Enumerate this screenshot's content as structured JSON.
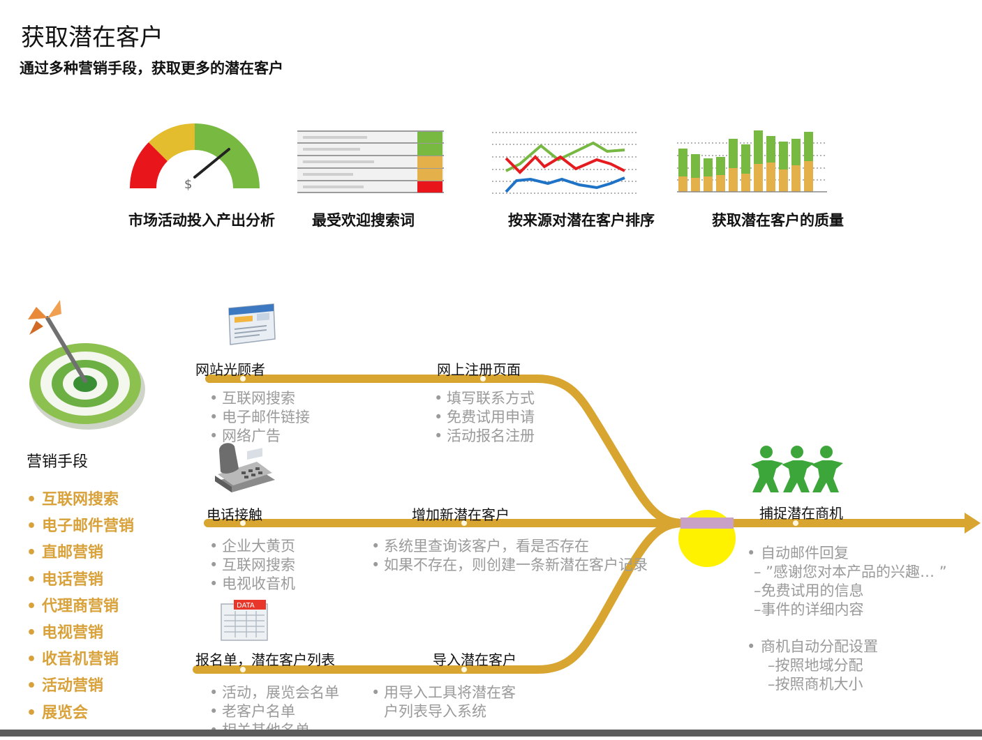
{
  "page": {
    "title": "获取潜在客户",
    "subtitle": "通过多种营销手段，获取更多的潜在客户"
  },
  "kpis": [
    {
      "label": "市场活动投入产出分析",
      "icon": "gauge-icon"
    },
    {
      "label": "最受欢迎搜索词",
      "icon": "table-bars-icon"
    },
    {
      "label": "按来源对潜在客户排序",
      "icon": "line-chart-icon"
    },
    {
      "label": "获取潜在客户的质量",
      "icon": "stacked-bar-icon"
    }
  ],
  "gauge": {
    "symbol": "$"
  },
  "marketing": {
    "heading": "营销手段",
    "items": [
      "互联网搜索",
      "电子邮件营销",
      "直邮营销",
      "电话营销",
      "代理商营销",
      "电视营销",
      "收音机营销",
      "活动营销",
      "展览会"
    ]
  },
  "stages": {
    "web_visitor": {
      "label": "网站光顾者",
      "bullets": [
        "互联网搜索",
        "电子邮件链接",
        "网络广告"
      ]
    },
    "web_register": {
      "label": "网上注册页面",
      "bullets": [
        "填写联系方式",
        "免费试用申请",
        "活动报名注册"
      ]
    },
    "phone": {
      "label": "电话接触",
      "bullets": [
        "企业大黄页",
        "互联网搜索",
        "电视收音机"
      ]
    },
    "add_lead": {
      "label": "增加新潜在客户",
      "bullets": [
        "系统里查询该客户，看是否存在",
        "如果不存在，则创建一条新潜在客户记录"
      ]
    },
    "signup_list": {
      "label": "报名单，潜在客户列表",
      "bullets": [
        "活动，展览会名单",
        "老客户名单",
        "相关其他名单"
      ]
    },
    "import_lead": {
      "label": "导入潜在客户",
      "bullets": [
        "用导入工具将潜在客",
        "户列表导入系统"
      ]
    },
    "capture": {
      "label": "捕捉潜在商机",
      "bullet1": "自动邮件回复",
      "bullet1_sub": [
        "– ”感谢您对本产品的兴趣… ”",
        "–免费试用的信息",
        "–事件的详细内容"
      ],
      "bullet2": "商机自动分配设置",
      "bullet2_sub": [
        "–按照地域分配",
        "–按照商机大小"
      ]
    }
  },
  "icons": {
    "data_label": "DATA"
  },
  "colors": {
    "flow": "#d9a531",
    "accent_gold": "#d8a13a",
    "merge_circle": "#fff200",
    "merge_band": "#c9a0c6",
    "gauge_red": "#e8151b",
    "gauge_yellow": "#e3bd2e",
    "gauge_green": "#78b942",
    "people_green": "#3da63a"
  },
  "bullet_char": "•"
}
